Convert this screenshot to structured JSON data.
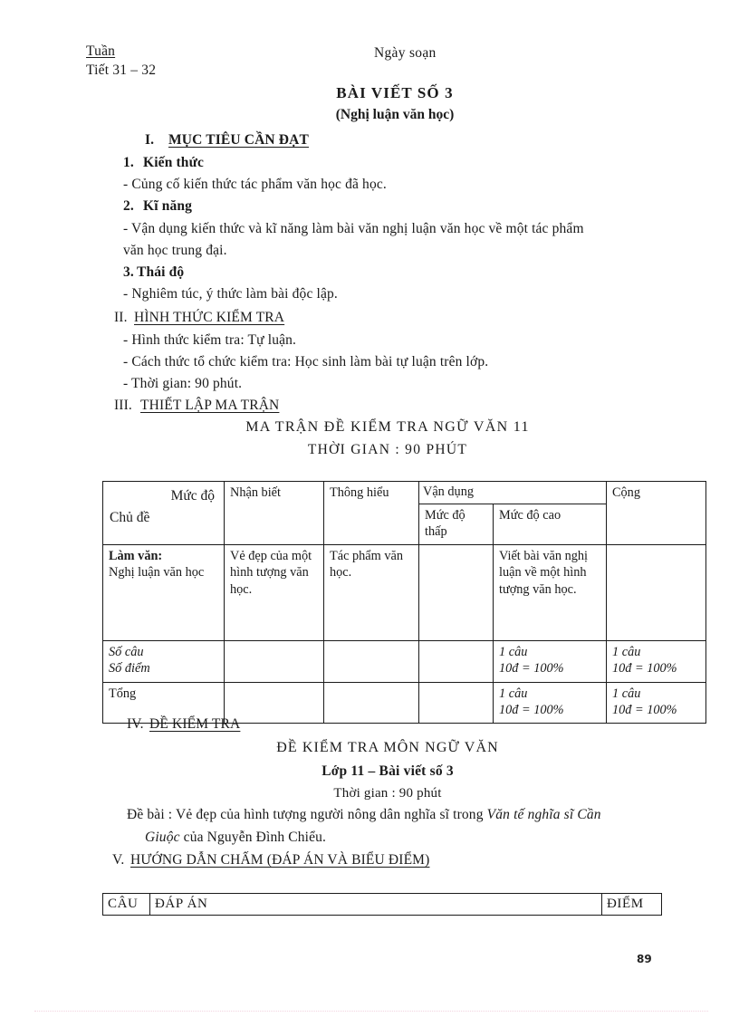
{
  "header": {
    "tuan": "Tuần",
    "tiet": "Tiết 31 – 32",
    "ngay_soan": "Ngày soạn"
  },
  "titles": {
    "main": "BÀI VIẾT SỐ 3",
    "sub": "(Nghị luận văn học)"
  },
  "sections": {
    "s1_num": "I.",
    "s1_title": "MỤC TIÊU CẦN ĐẠT",
    "s1_1_num": "1.",
    "s1_1_title": "Kiến thức",
    "s1_1_body": "- Củng cố kiến thức tác phẩm văn học đã học.",
    "s1_2_num": "2.",
    "s1_2_title": "Kĩ năng",
    "s1_2_body_line1": "- Vận dụng kiến thức và kĩ năng làm bài văn nghị luận văn học về một tác phẩm",
    "s1_2_body_line2": "văn học trung đại.",
    "s1_3_num": "3.",
    "s1_3_title": "Thái độ",
    "s1_3_body": "- Nghiêm túc, ý thức làm bài độc lập.",
    "s2_num": "II.",
    "s2_title": "HÌNH THỨC KIỂM TRA",
    "s2_body1": "- Hình thức kiểm tra: Tự luận.",
    "s2_body2": "- Cách thức tổ chức kiểm tra: Học sinh làm bài tự luận trên lớp.",
    "s2_body3": "- Thời gian: 90 phút.",
    "s3_num": "III.",
    "s3_title": "THIẾT LẬP MA TRẬN",
    "s3_center1": "MA TRẬN ĐỀ KIỂM TRA NGỮ VĂN 11",
    "s3_center2": "THỜI GIAN : 90 PHÚT",
    "s4_num": "IV.",
    "s4_title": "ĐỀ KIỂM TRA",
    "s4_center1": "ĐỀ KIỂM TRA MÔN NGỮ VĂN",
    "s4_center2": "Lớp 11 – Bài viết số 3",
    "s4_center3": "Thời gian : 90 phút",
    "s4_de_bai_pre": "Đề bài : Vẻ đẹp của hình tượng người nông dân nghĩa sĩ trong ",
    "s4_de_bai_italic1": "Văn tế nghĩa sĩ Cần",
    "s4_de_bai_italic2": "Giuộc",
    "s4_de_bai_post": " của Nguyễn Đình Chiểu.",
    "s5_num": "V.",
    "s5_title": "HƯỚNG DẪN CHẤM (ĐÁP ÁN VÀ BIỂU ĐIỂM)"
  },
  "matrix_table": {
    "corner_top": "Mức độ",
    "corner_bottom": "Chủ đề",
    "col_nhan_biet": "Nhận biết",
    "col_thong_hieu": "Thông hiểu",
    "col_van_dung": "Vận dụng",
    "col_muc_do_thap": "Mức độ thấp",
    "col_muc_do_cao": "Mức độ cao",
    "col_cong": "Cộng",
    "row1": {
      "subject_bold": "Làm văn:",
      "subject_rest": "Nghị luận văn học",
      "nhan_biet": "Vẻ đẹp của một hình tượng văn học.",
      "thong_hieu": "Tác phẩm văn học.",
      "muc_do_thap": "",
      "muc_do_cao": "Viết bài văn nghị luận về một hình tượng văn học.",
      "cong": ""
    },
    "row2": {
      "label_line1": "Số câu",
      "label_line2": "Số điểm",
      "nhan_biet": "",
      "thong_hieu": "",
      "muc_do_thap": "",
      "muc_do_cao_line1": "1 câu",
      "muc_do_cao_line2": "10đ = 100%",
      "cong_line1": "1 câu",
      "cong_line2": "10đ = 100%"
    },
    "row3": {
      "label": "Tổng",
      "nhan_biet": "",
      "thong_hieu": "",
      "muc_do_thap": "",
      "muc_do_cao_line1": "1 câu",
      "muc_do_cao_line2": "10đ = 100%",
      "cong_line1": "1 câu",
      "cong_line2": "10đ = 100%"
    }
  },
  "key_table": {
    "col_cau": "CÂU",
    "col_dap_an": "ĐÁP ÁN",
    "col_diem": "ĐIỂM"
  },
  "footer": {
    "page_number": "89"
  }
}
